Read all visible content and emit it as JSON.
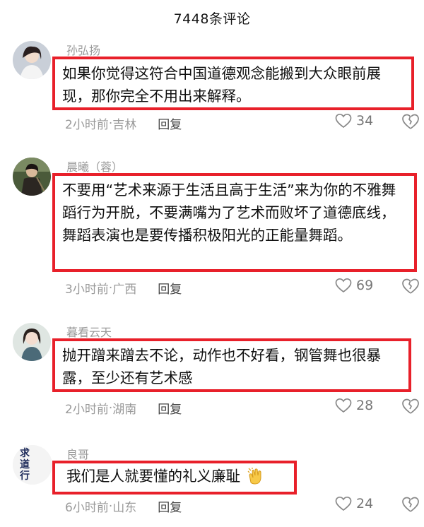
{
  "header": {
    "title": "7448条评论"
  },
  "comments": [
    {
      "username": "孙弘扬",
      "text": "如果你觉得这符合中国道德观念能搬到大众眼前展现，那你完全不用出来解释。",
      "time": "2小时前",
      "location": "吉林",
      "reply_label": "回复",
      "likes": "34"
    },
    {
      "username": "晨曦（蓉）",
      "text": "不要用“艺术来源于生活且高于生活”来为你的不雅舞蹈行为开脱，不要满嘴为了艺术而败坏了道德底线，舞蹈表演也是要传播积极阳光的正能量舞蹈。",
      "time": "3小时前",
      "location": "广西",
      "reply_label": "回复",
      "likes": "69"
    },
    {
      "username": "暮看云天",
      "text": "抛开蹭来蹭去不论，动作也不好看，钢管舞也很暴露，至少还有艺术感",
      "time": "2小时前",
      "location": "湖南",
      "reply_label": "回复",
      "likes": "28"
    },
    {
      "username": "良哥",
      "avatar_text": "求道行",
      "text": "我们是人就要懂的礼义廉耻",
      "time": "6小时前",
      "location": "山东",
      "reply_label": "回复",
      "likes": "24"
    }
  ],
  "meta_separator": " · ",
  "colors": {
    "highlight_border": "#e8202a",
    "meta_text": "#9a9a9a"
  },
  "icons": {
    "like": "heart-outline-icon",
    "dislike": "broken-heart-icon",
    "emoji": "clapping-hands-emoji"
  }
}
